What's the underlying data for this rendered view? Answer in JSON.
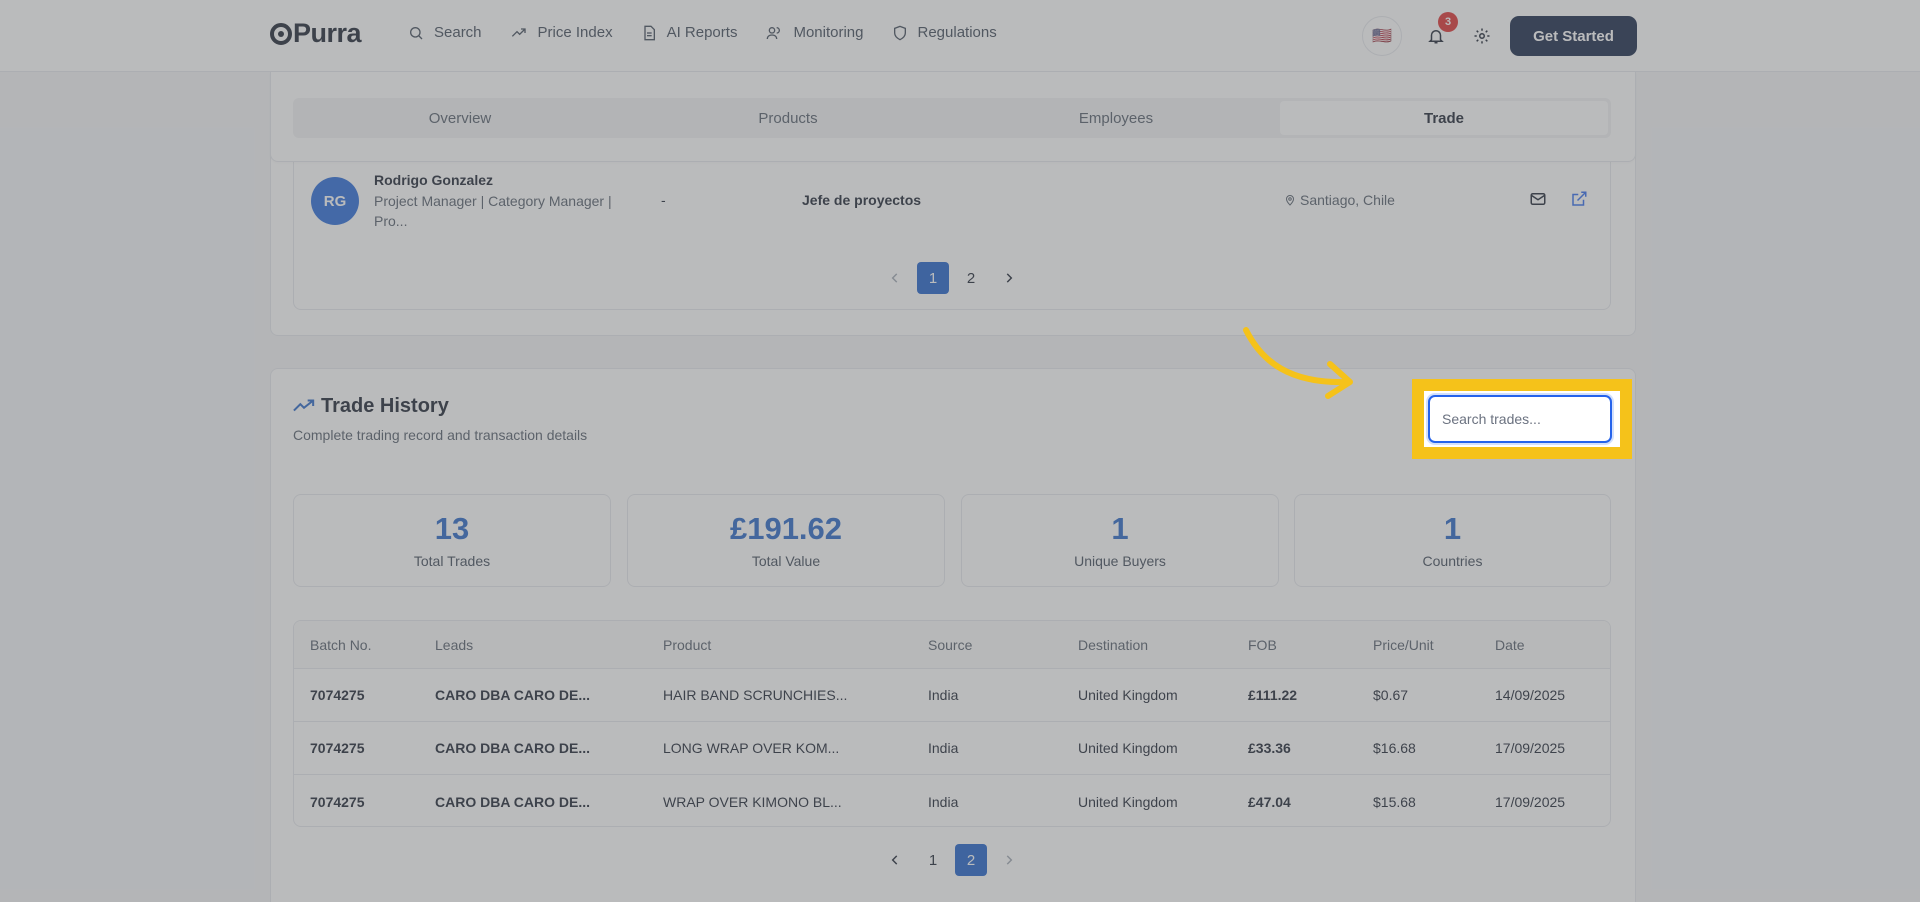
{
  "nav": {
    "logo": "Purra",
    "links": [
      {
        "label": "Search",
        "icon": "search-icon"
      },
      {
        "label": "Price Index",
        "icon": "trend-icon"
      },
      {
        "label": "AI Reports",
        "icon": "document-icon"
      },
      {
        "label": "Monitoring",
        "icon": "users-icon"
      },
      {
        "label": "Regulations",
        "icon": "shield-icon"
      }
    ],
    "flag": "🇺🇸",
    "notifications": "3",
    "cta": "Get Started"
  },
  "tabs": [
    "Overview",
    "Products",
    "Employees",
    "Trade"
  ],
  "active_tab": "Trade",
  "employee": {
    "initials": "RG",
    "name": "Rodrigo Gonzalez",
    "title": "Project Manager | Category Manager | Pro...",
    "dash": "-",
    "role": "Jefe de proyectos",
    "location": "Santiago, Chile"
  },
  "employee_pager": {
    "pages": [
      "1",
      "2"
    ],
    "current": "1"
  },
  "trade": {
    "title": "Trade History",
    "subtitle": "Complete trading record and transaction details",
    "search_placeholder": "Search trades...",
    "stats": [
      {
        "value": "13",
        "label": "Total Trades"
      },
      {
        "value": "£191.62",
        "label": "Total Value"
      },
      {
        "value": "1",
        "label": "Unique Buyers"
      },
      {
        "value": "1",
        "label": "Countries"
      }
    ],
    "columns": [
      "Batch No.",
      "Leads",
      "Product",
      "Source",
      "Destination",
      "FOB",
      "Price/Unit",
      "Date"
    ],
    "rows": [
      [
        "7074275",
        "CARO DBA CARO DE...",
        "HAIR BAND SCRUNCHIES...",
        "India",
        "United Kingdom",
        "£111.22",
        "$0.67",
        "14/09/2025"
      ],
      [
        "7074275",
        "CARO DBA CARO DE...",
        "LONG WRAP OVER KOM...",
        "India",
        "United Kingdom",
        "£33.36",
        "$16.68",
        "17/09/2025"
      ],
      [
        "7074275",
        "CARO DBA CARO DE...",
        "WRAP OVER KIMONO BL...",
        "India",
        "United Kingdom",
        "£47.04",
        "$15.68",
        "17/09/2025"
      ]
    ],
    "pager": {
      "pages": [
        "1",
        "2"
      ],
      "current": "2"
    }
  },
  "colors": {
    "accent": "#1d5fc4",
    "highlight": "#f5c21a",
    "cta": "#0b1b3f"
  }
}
